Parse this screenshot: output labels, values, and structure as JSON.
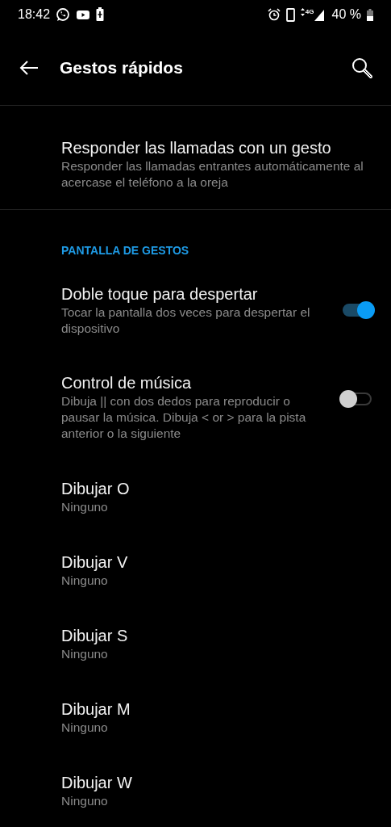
{
  "status_bar": {
    "time": "18:42",
    "network_type": "4G",
    "battery": "40 %"
  },
  "toolbar": {
    "title": "Gestos rápidos"
  },
  "sections": [
    {
      "items": [
        {
          "kind": "plain",
          "title": "Responder las llamadas con un gesto",
          "summary": "Responder las llamadas entrantes automáticamente al acercase el teléfono a la oreja"
        }
      ]
    },
    {
      "header": "PANTALLA DE GESTOS",
      "items": [
        {
          "kind": "switch",
          "title": "Doble toque para despertar",
          "summary": "Tocar la pantalla dos veces para despertar el dispositivo",
          "on": true
        },
        {
          "kind": "switch",
          "title": "Control de música",
          "summary": "Dibuja || con dos dedos para reproducir o pausar la música. Dibuja < or > para la pista anterior o la siguiente",
          "on": false
        },
        {
          "kind": "value",
          "title": "Dibujar O",
          "summary": "Ninguno"
        },
        {
          "kind": "value",
          "title": "Dibujar V",
          "summary": "Ninguno"
        },
        {
          "kind": "value",
          "title": "Dibujar S",
          "summary": "Ninguno"
        },
        {
          "kind": "value",
          "title": "Dibujar M",
          "summary": "Ninguno"
        },
        {
          "kind": "value",
          "title": "Dibujar W",
          "summary": "Ninguno"
        }
      ]
    }
  ]
}
